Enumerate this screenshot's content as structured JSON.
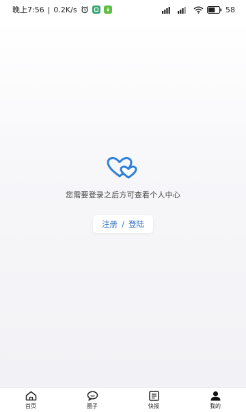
{
  "status_bar": {
    "time": "晚上7:56",
    "speed": "0.2K/s",
    "battery": "58"
  },
  "main": {
    "prompt": "您需要登录之后方可查看个人中心",
    "register_label": "注册",
    "separator": "/",
    "login_label": "登陆"
  },
  "tabs": [
    {
      "label": "首页",
      "icon": "home-icon"
    },
    {
      "label": "圈子",
      "icon": "chat-bubble-icon"
    },
    {
      "label": "快报",
      "icon": "news-icon"
    },
    {
      "label": "我的",
      "icon": "user-icon"
    }
  ],
  "colors": {
    "accent": "#2b6fc3",
    "heart_blue": "#2f80d8"
  }
}
